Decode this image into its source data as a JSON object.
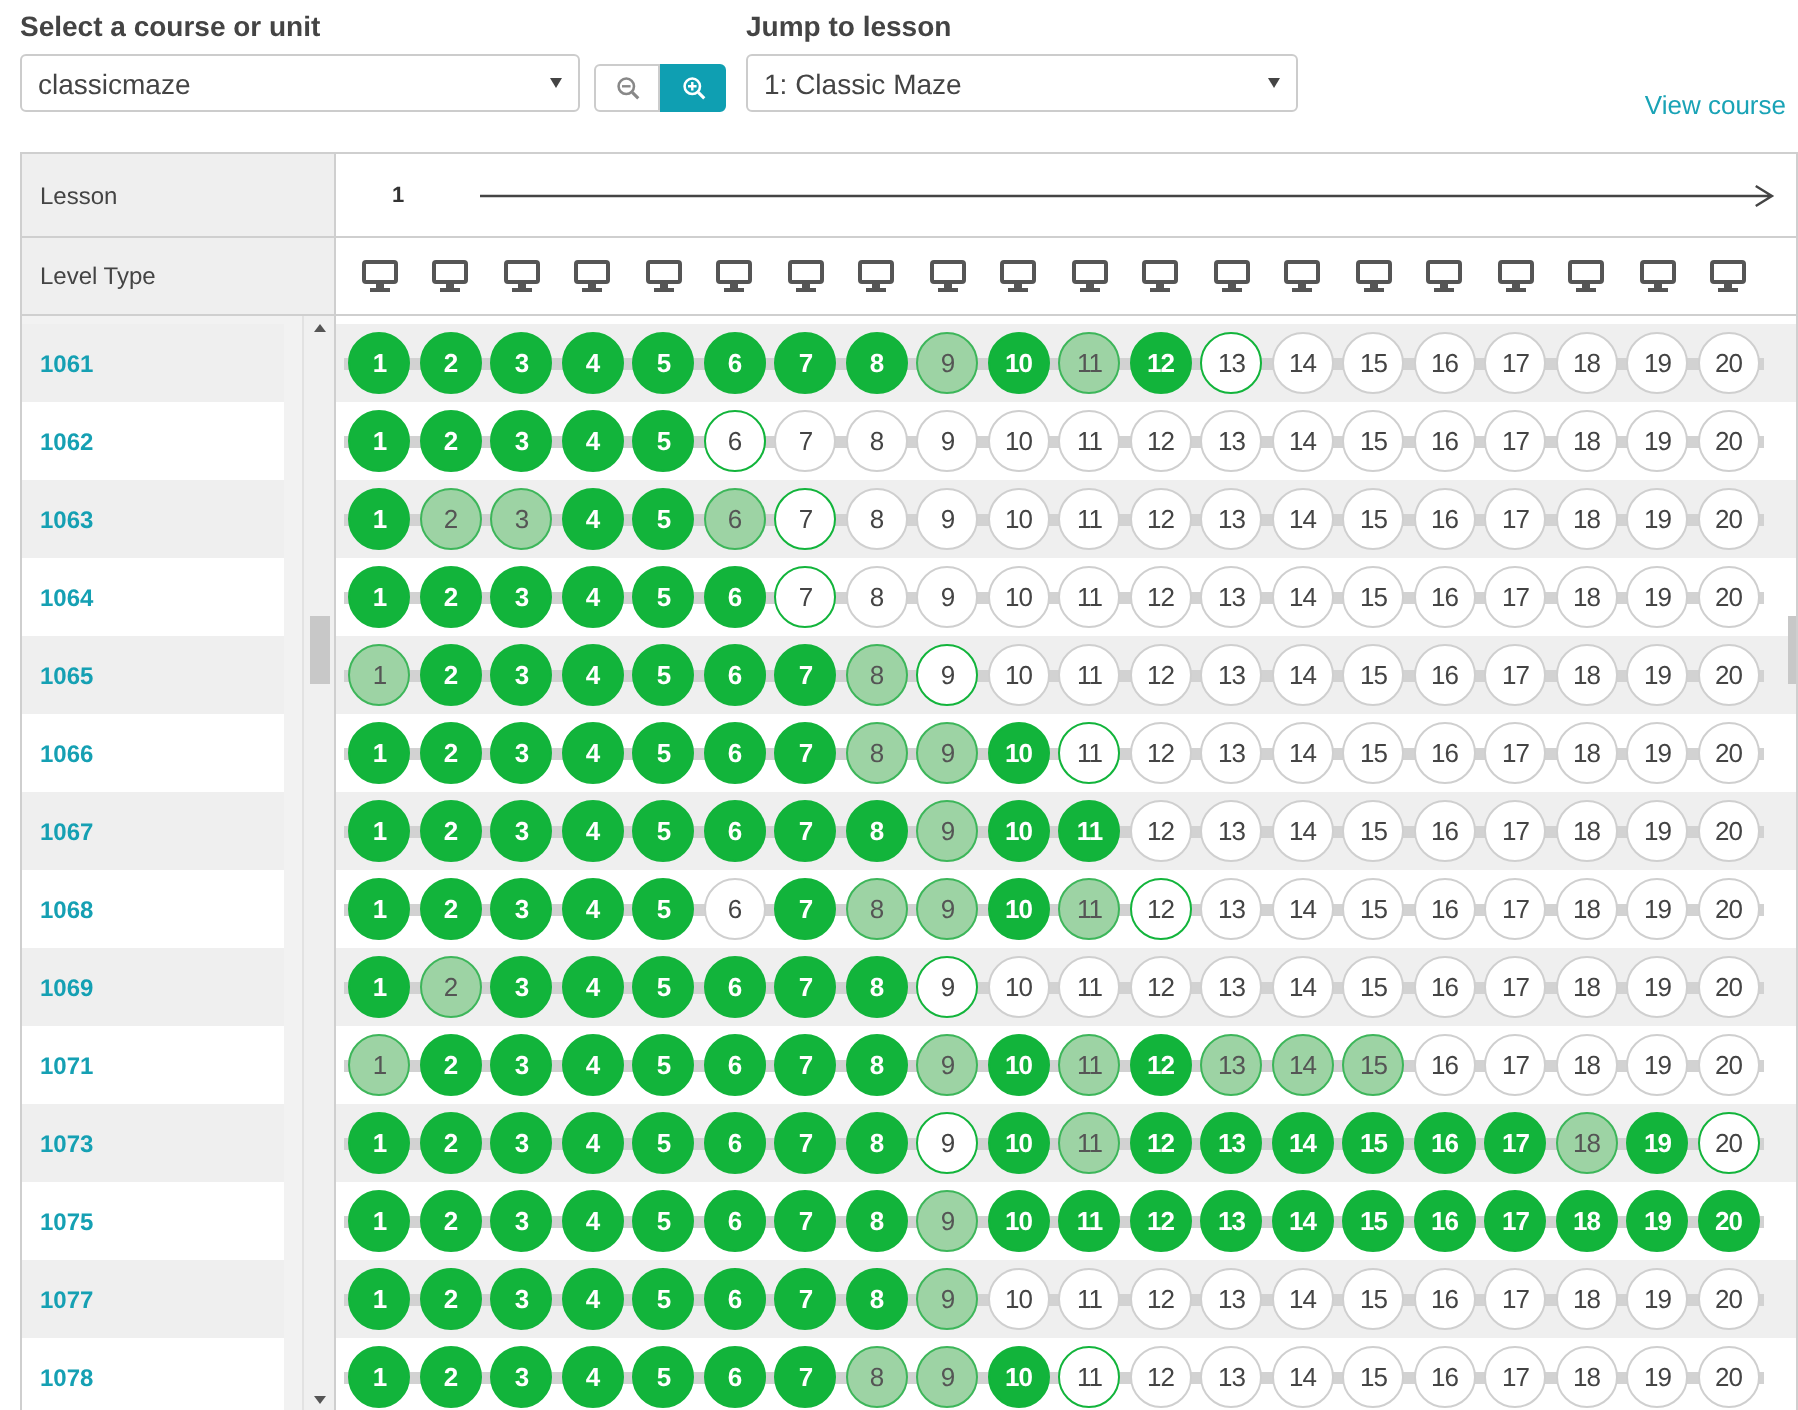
{
  "course_select": {
    "label": "Select a course or unit",
    "value": "classicmaze"
  },
  "zoom_buttons": [
    {
      "kind": "zoom-out",
      "selected": false
    },
    {
      "kind": "zoom-in",
      "selected": true
    }
  ],
  "lesson_select": {
    "label": "Jump to lesson",
    "value": "1: Classic Maze"
  },
  "view_course_link": "View course",
  "table": {
    "lesson_label": "Lesson",
    "lesson_number": "1",
    "level_type_label": "Level Type",
    "level_types": [
      {
        "kind": "desktop"
      },
      {
        "kind": "desktop"
      },
      {
        "kind": "desktop"
      },
      {
        "kind": "desktop"
      },
      {
        "kind": "desktop"
      },
      {
        "kind": "desktop"
      },
      {
        "kind": "desktop"
      },
      {
        "kind": "desktop"
      },
      {
        "kind": "desktop"
      },
      {
        "kind": "desktop"
      },
      {
        "kind": "desktop"
      },
      {
        "kind": "desktop"
      },
      {
        "kind": "desktop"
      },
      {
        "kind": "desktop"
      },
      {
        "kind": "desktop"
      },
      {
        "kind": "desktop"
      },
      {
        "kind": "desktop"
      },
      {
        "kind": "desktop"
      },
      {
        "kind": "desktop"
      },
      {
        "kind": "desktop"
      }
    ],
    "rows": [
      {
        "student": "1061",
        "levels": [
          {
            "label": "1",
            "kind": "perfect"
          },
          {
            "label": "2",
            "kind": "perfect"
          },
          {
            "label": "3",
            "kind": "perfect"
          },
          {
            "label": "4",
            "kind": "perfect"
          },
          {
            "label": "5",
            "kind": "perfect"
          },
          {
            "label": "6",
            "kind": "perfect"
          },
          {
            "label": "7",
            "kind": "perfect"
          },
          {
            "label": "8",
            "kind": "perfect"
          },
          {
            "label": "9",
            "kind": "passed"
          },
          {
            "label": "10",
            "kind": "perfect"
          },
          {
            "label": "11",
            "kind": "passed"
          },
          {
            "label": "12",
            "kind": "perfect"
          },
          {
            "label": "13",
            "kind": "attempted"
          },
          {
            "label": "14",
            "kind": "unstarted"
          },
          {
            "label": "15",
            "kind": "unstarted"
          },
          {
            "label": "16",
            "kind": "unstarted"
          },
          {
            "label": "17",
            "kind": "unstarted"
          },
          {
            "label": "18",
            "kind": "unstarted"
          },
          {
            "label": "19",
            "kind": "unstarted"
          },
          {
            "label": "20",
            "kind": "unstarted"
          }
        ]
      },
      {
        "student": "1062",
        "levels": [
          {
            "label": "1",
            "kind": "perfect"
          },
          {
            "label": "2",
            "kind": "perfect"
          },
          {
            "label": "3",
            "kind": "perfect"
          },
          {
            "label": "4",
            "kind": "perfect"
          },
          {
            "label": "5",
            "kind": "perfect"
          },
          {
            "label": "6",
            "kind": "attempted"
          },
          {
            "label": "7",
            "kind": "unstarted"
          },
          {
            "label": "8",
            "kind": "unstarted"
          },
          {
            "label": "9",
            "kind": "unstarted"
          },
          {
            "label": "10",
            "kind": "unstarted"
          },
          {
            "label": "11",
            "kind": "unstarted"
          },
          {
            "label": "12",
            "kind": "unstarted"
          },
          {
            "label": "13",
            "kind": "unstarted"
          },
          {
            "label": "14",
            "kind": "unstarted"
          },
          {
            "label": "15",
            "kind": "unstarted"
          },
          {
            "label": "16",
            "kind": "unstarted"
          },
          {
            "label": "17",
            "kind": "unstarted"
          },
          {
            "label": "18",
            "kind": "unstarted"
          },
          {
            "label": "19",
            "kind": "unstarted"
          },
          {
            "label": "20",
            "kind": "unstarted"
          }
        ]
      },
      {
        "student": "1063",
        "levels": [
          {
            "label": "1",
            "kind": "perfect"
          },
          {
            "label": "2",
            "kind": "passed"
          },
          {
            "label": "3",
            "kind": "passed"
          },
          {
            "label": "4",
            "kind": "perfect"
          },
          {
            "label": "5",
            "kind": "perfect"
          },
          {
            "label": "6",
            "kind": "passed"
          },
          {
            "label": "7",
            "kind": "attempted"
          },
          {
            "label": "8",
            "kind": "unstarted"
          },
          {
            "label": "9",
            "kind": "unstarted"
          },
          {
            "label": "10",
            "kind": "unstarted"
          },
          {
            "label": "11",
            "kind": "unstarted"
          },
          {
            "label": "12",
            "kind": "unstarted"
          },
          {
            "label": "13",
            "kind": "unstarted"
          },
          {
            "label": "14",
            "kind": "unstarted"
          },
          {
            "label": "15",
            "kind": "unstarted"
          },
          {
            "label": "16",
            "kind": "unstarted"
          },
          {
            "label": "17",
            "kind": "unstarted"
          },
          {
            "label": "18",
            "kind": "unstarted"
          },
          {
            "label": "19",
            "kind": "unstarted"
          },
          {
            "label": "20",
            "kind": "unstarted"
          }
        ]
      },
      {
        "student": "1064",
        "levels": [
          {
            "label": "1",
            "kind": "perfect"
          },
          {
            "label": "2",
            "kind": "perfect"
          },
          {
            "label": "3",
            "kind": "perfect"
          },
          {
            "label": "4",
            "kind": "perfect"
          },
          {
            "label": "5",
            "kind": "perfect"
          },
          {
            "label": "6",
            "kind": "perfect"
          },
          {
            "label": "7",
            "kind": "attempted"
          },
          {
            "label": "8",
            "kind": "unstarted"
          },
          {
            "label": "9",
            "kind": "unstarted"
          },
          {
            "label": "10",
            "kind": "unstarted"
          },
          {
            "label": "11",
            "kind": "unstarted"
          },
          {
            "label": "12",
            "kind": "unstarted"
          },
          {
            "label": "13",
            "kind": "unstarted"
          },
          {
            "label": "14",
            "kind": "unstarted"
          },
          {
            "label": "15",
            "kind": "unstarted"
          },
          {
            "label": "16",
            "kind": "unstarted"
          },
          {
            "label": "17",
            "kind": "unstarted"
          },
          {
            "label": "18",
            "kind": "unstarted"
          },
          {
            "label": "19",
            "kind": "unstarted"
          },
          {
            "label": "20",
            "kind": "unstarted"
          }
        ]
      },
      {
        "student": "1065",
        "levels": [
          {
            "label": "1",
            "kind": "passed"
          },
          {
            "label": "2",
            "kind": "perfect"
          },
          {
            "label": "3",
            "kind": "perfect"
          },
          {
            "label": "4",
            "kind": "perfect"
          },
          {
            "label": "5",
            "kind": "perfect"
          },
          {
            "label": "6",
            "kind": "perfect"
          },
          {
            "label": "7",
            "kind": "perfect"
          },
          {
            "label": "8",
            "kind": "passed"
          },
          {
            "label": "9",
            "kind": "attempted"
          },
          {
            "label": "10",
            "kind": "unstarted"
          },
          {
            "label": "11",
            "kind": "unstarted"
          },
          {
            "label": "12",
            "kind": "unstarted"
          },
          {
            "label": "13",
            "kind": "unstarted"
          },
          {
            "label": "14",
            "kind": "unstarted"
          },
          {
            "label": "15",
            "kind": "unstarted"
          },
          {
            "label": "16",
            "kind": "unstarted"
          },
          {
            "label": "17",
            "kind": "unstarted"
          },
          {
            "label": "18",
            "kind": "unstarted"
          },
          {
            "label": "19",
            "kind": "unstarted"
          },
          {
            "label": "20",
            "kind": "unstarted"
          }
        ]
      },
      {
        "student": "1066",
        "levels": [
          {
            "label": "1",
            "kind": "perfect"
          },
          {
            "label": "2",
            "kind": "perfect"
          },
          {
            "label": "3",
            "kind": "perfect"
          },
          {
            "label": "4",
            "kind": "perfect"
          },
          {
            "label": "5",
            "kind": "perfect"
          },
          {
            "label": "6",
            "kind": "perfect"
          },
          {
            "label": "7",
            "kind": "perfect"
          },
          {
            "label": "8",
            "kind": "passed"
          },
          {
            "label": "9",
            "kind": "passed"
          },
          {
            "label": "10",
            "kind": "perfect"
          },
          {
            "label": "11",
            "kind": "attempted"
          },
          {
            "label": "12",
            "kind": "unstarted"
          },
          {
            "label": "13",
            "kind": "unstarted"
          },
          {
            "label": "14",
            "kind": "unstarted"
          },
          {
            "label": "15",
            "kind": "unstarted"
          },
          {
            "label": "16",
            "kind": "unstarted"
          },
          {
            "label": "17",
            "kind": "unstarted"
          },
          {
            "label": "18",
            "kind": "unstarted"
          },
          {
            "label": "19",
            "kind": "unstarted"
          },
          {
            "label": "20",
            "kind": "unstarted"
          }
        ]
      },
      {
        "student": "1067",
        "levels": [
          {
            "label": "1",
            "kind": "perfect"
          },
          {
            "label": "2",
            "kind": "perfect"
          },
          {
            "label": "3",
            "kind": "perfect"
          },
          {
            "label": "4",
            "kind": "perfect"
          },
          {
            "label": "5",
            "kind": "perfect"
          },
          {
            "label": "6",
            "kind": "perfect"
          },
          {
            "label": "7",
            "kind": "perfect"
          },
          {
            "label": "8",
            "kind": "perfect"
          },
          {
            "label": "9",
            "kind": "passed"
          },
          {
            "label": "10",
            "kind": "perfect"
          },
          {
            "label": "11",
            "kind": "perfect"
          },
          {
            "label": "12",
            "kind": "unstarted"
          },
          {
            "label": "13",
            "kind": "unstarted"
          },
          {
            "label": "14",
            "kind": "unstarted"
          },
          {
            "label": "15",
            "kind": "unstarted"
          },
          {
            "label": "16",
            "kind": "unstarted"
          },
          {
            "label": "17",
            "kind": "unstarted"
          },
          {
            "label": "18",
            "kind": "unstarted"
          },
          {
            "label": "19",
            "kind": "unstarted"
          },
          {
            "label": "20",
            "kind": "unstarted"
          }
        ]
      },
      {
        "student": "1068",
        "levels": [
          {
            "label": "1",
            "kind": "perfect"
          },
          {
            "label": "2",
            "kind": "perfect"
          },
          {
            "label": "3",
            "kind": "perfect"
          },
          {
            "label": "4",
            "kind": "perfect"
          },
          {
            "label": "5",
            "kind": "perfect"
          },
          {
            "label": "6",
            "kind": "unstarted"
          },
          {
            "label": "7",
            "kind": "perfect"
          },
          {
            "label": "8",
            "kind": "passed"
          },
          {
            "label": "9",
            "kind": "passed"
          },
          {
            "label": "10",
            "kind": "perfect"
          },
          {
            "label": "11",
            "kind": "passed"
          },
          {
            "label": "12",
            "kind": "attempted"
          },
          {
            "label": "13",
            "kind": "unstarted"
          },
          {
            "label": "14",
            "kind": "unstarted"
          },
          {
            "label": "15",
            "kind": "unstarted"
          },
          {
            "label": "16",
            "kind": "unstarted"
          },
          {
            "label": "17",
            "kind": "unstarted"
          },
          {
            "label": "18",
            "kind": "unstarted"
          },
          {
            "label": "19",
            "kind": "unstarted"
          },
          {
            "label": "20",
            "kind": "unstarted"
          }
        ]
      },
      {
        "student": "1069",
        "levels": [
          {
            "label": "1",
            "kind": "perfect"
          },
          {
            "label": "2",
            "kind": "passed"
          },
          {
            "label": "3",
            "kind": "perfect"
          },
          {
            "label": "4",
            "kind": "perfect"
          },
          {
            "label": "5",
            "kind": "perfect"
          },
          {
            "label": "6",
            "kind": "perfect"
          },
          {
            "label": "7",
            "kind": "perfect"
          },
          {
            "label": "8",
            "kind": "perfect"
          },
          {
            "label": "9",
            "kind": "attempted"
          },
          {
            "label": "10",
            "kind": "unstarted"
          },
          {
            "label": "11",
            "kind": "unstarted"
          },
          {
            "label": "12",
            "kind": "unstarted"
          },
          {
            "label": "13",
            "kind": "unstarted"
          },
          {
            "label": "14",
            "kind": "unstarted"
          },
          {
            "label": "15",
            "kind": "unstarted"
          },
          {
            "label": "16",
            "kind": "unstarted"
          },
          {
            "label": "17",
            "kind": "unstarted"
          },
          {
            "label": "18",
            "kind": "unstarted"
          },
          {
            "label": "19",
            "kind": "unstarted"
          },
          {
            "label": "20",
            "kind": "unstarted"
          }
        ]
      },
      {
        "student": "1071",
        "levels": [
          {
            "label": "1",
            "kind": "passed"
          },
          {
            "label": "2",
            "kind": "perfect"
          },
          {
            "label": "3",
            "kind": "perfect"
          },
          {
            "label": "4",
            "kind": "perfect"
          },
          {
            "label": "5",
            "kind": "perfect"
          },
          {
            "label": "6",
            "kind": "perfect"
          },
          {
            "label": "7",
            "kind": "perfect"
          },
          {
            "label": "8",
            "kind": "perfect"
          },
          {
            "label": "9",
            "kind": "passed"
          },
          {
            "label": "10",
            "kind": "perfect"
          },
          {
            "label": "11",
            "kind": "passed"
          },
          {
            "label": "12",
            "kind": "perfect"
          },
          {
            "label": "13",
            "kind": "passed"
          },
          {
            "label": "14",
            "kind": "passed"
          },
          {
            "label": "15",
            "kind": "passed"
          },
          {
            "label": "16",
            "kind": "unstarted"
          },
          {
            "label": "17",
            "kind": "unstarted"
          },
          {
            "label": "18",
            "kind": "unstarted"
          },
          {
            "label": "19",
            "kind": "unstarted"
          },
          {
            "label": "20",
            "kind": "unstarted"
          }
        ]
      },
      {
        "student": "1073",
        "levels": [
          {
            "label": "1",
            "kind": "perfect"
          },
          {
            "label": "2",
            "kind": "perfect"
          },
          {
            "label": "3",
            "kind": "perfect"
          },
          {
            "label": "4",
            "kind": "perfect"
          },
          {
            "label": "5",
            "kind": "perfect"
          },
          {
            "label": "6",
            "kind": "perfect"
          },
          {
            "label": "7",
            "kind": "perfect"
          },
          {
            "label": "8",
            "kind": "perfect"
          },
          {
            "label": "9",
            "kind": "attempted"
          },
          {
            "label": "10",
            "kind": "perfect"
          },
          {
            "label": "11",
            "kind": "passed"
          },
          {
            "label": "12",
            "kind": "perfect"
          },
          {
            "label": "13",
            "kind": "perfect"
          },
          {
            "label": "14",
            "kind": "perfect"
          },
          {
            "label": "15",
            "kind": "perfect"
          },
          {
            "label": "16",
            "kind": "perfect"
          },
          {
            "label": "17",
            "kind": "perfect"
          },
          {
            "label": "18",
            "kind": "passed"
          },
          {
            "label": "19",
            "kind": "perfect"
          },
          {
            "label": "20",
            "kind": "attempted"
          }
        ]
      },
      {
        "student": "1075",
        "levels": [
          {
            "label": "1",
            "kind": "perfect"
          },
          {
            "label": "2",
            "kind": "perfect"
          },
          {
            "label": "3",
            "kind": "perfect"
          },
          {
            "label": "4",
            "kind": "perfect"
          },
          {
            "label": "5",
            "kind": "perfect"
          },
          {
            "label": "6",
            "kind": "perfect"
          },
          {
            "label": "7",
            "kind": "perfect"
          },
          {
            "label": "8",
            "kind": "perfect"
          },
          {
            "label": "9",
            "kind": "passed"
          },
          {
            "label": "10",
            "kind": "perfect"
          },
          {
            "label": "11",
            "kind": "perfect"
          },
          {
            "label": "12",
            "kind": "perfect"
          },
          {
            "label": "13",
            "kind": "perfect"
          },
          {
            "label": "14",
            "kind": "perfect"
          },
          {
            "label": "15",
            "kind": "perfect"
          },
          {
            "label": "16",
            "kind": "perfect"
          },
          {
            "label": "17",
            "kind": "perfect"
          },
          {
            "label": "18",
            "kind": "perfect"
          },
          {
            "label": "19",
            "kind": "perfect"
          },
          {
            "label": "20",
            "kind": "perfect"
          }
        ]
      },
      {
        "student": "1077",
        "levels": [
          {
            "label": "1",
            "kind": "perfect"
          },
          {
            "label": "2",
            "kind": "perfect"
          },
          {
            "label": "3",
            "kind": "perfect"
          },
          {
            "label": "4",
            "kind": "perfect"
          },
          {
            "label": "5",
            "kind": "perfect"
          },
          {
            "label": "6",
            "kind": "perfect"
          },
          {
            "label": "7",
            "kind": "perfect"
          },
          {
            "label": "8",
            "kind": "perfect"
          },
          {
            "label": "9",
            "kind": "passed"
          },
          {
            "label": "10",
            "kind": "unstarted"
          },
          {
            "label": "11",
            "kind": "unstarted"
          },
          {
            "label": "12",
            "kind": "unstarted"
          },
          {
            "label": "13",
            "kind": "unstarted"
          },
          {
            "label": "14",
            "kind": "unstarted"
          },
          {
            "label": "15",
            "kind": "unstarted"
          },
          {
            "label": "16",
            "kind": "unstarted"
          },
          {
            "label": "17",
            "kind": "unstarted"
          },
          {
            "label": "18",
            "kind": "unstarted"
          },
          {
            "label": "19",
            "kind": "unstarted"
          },
          {
            "label": "20",
            "kind": "unstarted"
          }
        ]
      },
      {
        "student": "1078",
        "levels": [
          {
            "label": "1",
            "kind": "perfect"
          },
          {
            "label": "2",
            "kind": "perfect"
          },
          {
            "label": "3",
            "kind": "perfect"
          },
          {
            "label": "4",
            "kind": "perfect"
          },
          {
            "label": "5",
            "kind": "perfect"
          },
          {
            "label": "6",
            "kind": "perfect"
          },
          {
            "label": "7",
            "kind": "perfect"
          },
          {
            "label": "8",
            "kind": "passed"
          },
          {
            "label": "9",
            "kind": "passed"
          },
          {
            "label": "10",
            "kind": "perfect"
          },
          {
            "label": "11",
            "kind": "attempted"
          },
          {
            "label": "12",
            "kind": "unstarted"
          },
          {
            "label": "13",
            "kind": "unstarted"
          },
          {
            "label": "14",
            "kind": "unstarted"
          },
          {
            "label": "15",
            "kind": "unstarted"
          },
          {
            "label": "16",
            "kind": "unstarted"
          },
          {
            "label": "17",
            "kind": "unstarted"
          },
          {
            "label": "18",
            "kind": "unstarted"
          },
          {
            "label": "19",
            "kind": "unstarted"
          },
          {
            "label": "20",
            "kind": "unstarted"
          }
        ]
      }
    ]
  }
}
